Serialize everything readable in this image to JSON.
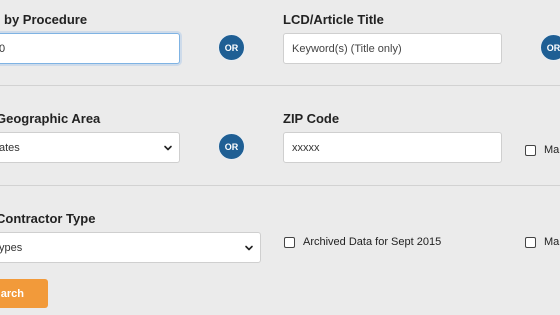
{
  "row1": {
    "procedure_label": "by Procedure",
    "procedure_value": "0",
    "or_label": "OR",
    "title_label": "LCD/Article Title",
    "title_placeholder": "Keyword(s) (Title only)",
    "or_label_right": "OR"
  },
  "row2": {
    "geo_label": "Geographic Area",
    "geo_selected": "ates",
    "or_label": "OR",
    "zip_label": "ZIP Code",
    "zip_placeholder": "xxxxx",
    "checkbox_right_label": "Mal"
  },
  "row3": {
    "contractor_label": "Contractor Type",
    "contractor_selected": "ypes",
    "archived_label": "Archived Data for Sept 2015",
    "checkbox_right_label": "Mal"
  },
  "search_button_label": "arch",
  "icons": {
    "select_chevron": "chevron-down-icon"
  },
  "colors": {
    "background": "#ebebeb",
    "or_badge": "#1f5f94",
    "search_button": "#f29a3a",
    "focus_border": "#7fb3e3"
  }
}
